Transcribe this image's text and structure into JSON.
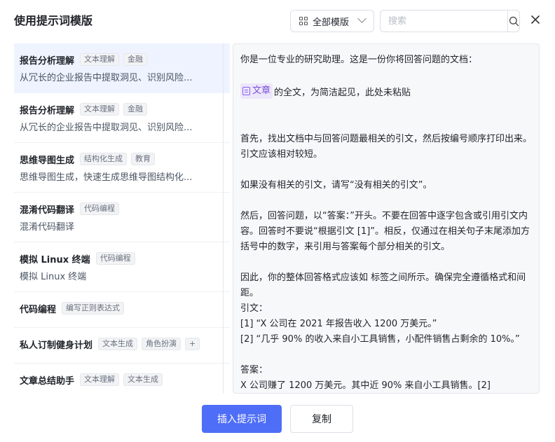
{
  "dialog": {
    "title": "使用提示词模版",
    "filter_label": "全部模版",
    "search_placeholder": "搜索"
  },
  "templates": [
    {
      "name": "报告分析理解",
      "tags": [
        "文本理解",
        "金融"
      ],
      "desc": "从冗长的企业报告中提取洞见、识别风险..."
    },
    {
      "name": "报告分析理解",
      "tags": [
        "文本理解",
        "金融"
      ],
      "desc": "从冗长的企业报告中提取洞见、识别风险..."
    },
    {
      "name": "思维导图生成",
      "tags": [
        "结构化生成",
        "教育"
      ],
      "desc": "思维导图生成，快速生成思维导图结构化..."
    },
    {
      "name": "混淆代码翻译",
      "tags": [
        "代码编程"
      ],
      "desc": "混淆代码翻译"
    },
    {
      "name": "模拟 Linux 终端",
      "tags": [
        "代码编程"
      ],
      "desc": "模拟 Linux 终端"
    },
    {
      "name": "代码编程",
      "tags": [
        "编写正则表达式"
      ],
      "desc": ""
    },
    {
      "name": "私人订制健身计划",
      "tags": [
        "文本生成",
        "角色扮演",
        "+"
      ],
      "desc": ""
    },
    {
      "name": "文章总结助手",
      "tags": [
        "文本理解",
        "文本生成"
      ],
      "desc": ""
    }
  ],
  "preview": {
    "line1": "你是一位专业的研究助理。这是一份你将回答问题的文档：",
    "chip": "文章",
    "line2_rest": "的全文，为简洁起见，此处未粘贴",
    "p1": "首先，找出文档中与回答问题最相关的引文，然后按编号顺序打印出来。引文应该相对较短。",
    "p2": "如果没有相关的引文，请写“没有相关的引文”。",
    "p3": "然后，回答问题，以“答案：”开头。不要在回答中逐字包含或引用引文内容。回答时不要说“根据引文 [1]”。相反，仅通过在相关句子末尾添加方括号中的数字，来引用与答案每个部分相关的引文。",
    "p4": "因此，你的整体回答格式应该如 标签之间所示。确保完全遵循格式和间距。",
    "p5": "引文：",
    "p6": "[1] “X 公司在 2021 年报告收入 1200 万美元。”",
    "p7": "[2] “几乎 90% 的收入来自小工具销售，小配件销售占剩余的 10%。”",
    "p8": "答案：",
    "p9": "X 公司赚了 1200 万美元。其中近 90% 来自小工具销售。[2]"
  },
  "actions": {
    "insert": "插入提示词",
    "copy": "复制"
  }
}
